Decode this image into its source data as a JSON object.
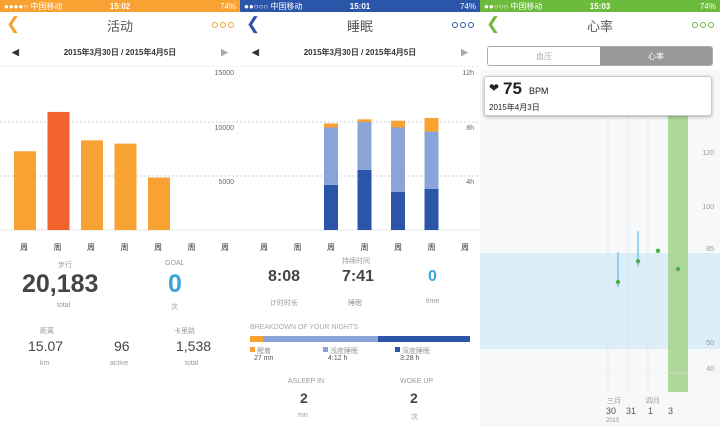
{
  "activity": {
    "status": {
      "carrier": "●●●●○ 中国移动",
      "time": "15:02",
      "battery": "74%"
    },
    "title": "活动",
    "date_range": "2015年3月30日 / 2015年4月5日",
    "ticks": [
      "15000",
      "10000",
      "5000"
    ],
    "days": [
      "周",
      "周",
      "周",
      "周",
      "周",
      "周",
      "周"
    ],
    "accent": "#f7a233",
    "highlight": "#f2622d",
    "steps_label": "步行",
    "steps_value": "20,183",
    "steps_unit": "total",
    "goal_label": "GOAL",
    "goal_value": "0",
    "goal_unit": "次",
    "distance_label": "距离",
    "distance_value": "15.07",
    "distance_unit": "km",
    "active_value": "96",
    "active_unit": "active",
    "calories_label": "卡里路",
    "calories_value": "1,538",
    "calories_unit": "total"
  },
  "sleep": {
    "status": {
      "carrier": "●●○○○ 中国移动",
      "time": "15:01",
      "battery": "74%"
    },
    "title": "睡眠",
    "date_range": "2015年3月30日 / 2015年4月5日",
    "ticks": [
      "12h",
      "8h",
      "4h"
    ],
    "days": [
      "周",
      "周",
      "周",
      "周",
      "周",
      "周",
      "周"
    ],
    "accent": "#2b55a8",
    "duration_label": "持续时间",
    "timer_value": "8:08",
    "timer_unit": "计时时长",
    "sleep_value": "7:41",
    "sleep_unit": "睡眠",
    "time_value": "0",
    "time_unit": "time",
    "breakdown_title": "BREAKDOWN OF YOUR NIGHTS",
    "awake_label": "醒着",
    "awake_value": "27 mn",
    "light_label": "浅度睡眠",
    "light_value": "4:12 h",
    "deep_label": "深度睡眠",
    "deep_value": "3:28 h",
    "asleep_label": "ASLEEP IN",
    "asleep_value": "2",
    "asleep_unit": "mn",
    "woke_label": "WOKE UP",
    "woke_value": "2",
    "woke_unit": "次"
  },
  "heart": {
    "status": {
      "carrier": "●●○○○ 中国移动",
      "time": "15:03",
      "battery": "74%"
    },
    "title": "心率",
    "tab_bp": "血压",
    "tab_hr": "心率",
    "tooltip_value": "75",
    "tooltip_unit": "BPM",
    "tooltip_date": "2015年4月3日",
    "ticks": [
      "120",
      "100",
      "85",
      "50",
      "40"
    ],
    "x_month1": "三月",
    "x_month2": "四月",
    "x_days": [
      "30",
      "31",
      "1",
      "3"
    ],
    "x_year": "2015",
    "accent": "#6cbb3c"
  },
  "chart_data": [
    {
      "type": "bar",
      "title": "活动",
      "categories": [
        "周",
        "周",
        "周",
        "周",
        "周",
        "周",
        "周"
      ],
      "values": [
        7200,
        10800,
        8200,
        7900,
        4800,
        0,
        0
      ],
      "ylim": [
        0,
        15000
      ]
    },
    {
      "type": "bar",
      "title": "睡眠",
      "categories": [
        "周",
        "周",
        "周",
        "周",
        "周",
        "周",
        "周"
      ],
      "series": [
        {
          "name": "深度睡眠",
          "values": [
            0,
            0,
            3.3,
            4.4,
            2.8,
            3.0,
            0
          ]
        },
        {
          "name": "浅度睡眠",
          "values": [
            0,
            0,
            4.2,
            3.5,
            4.7,
            4.2,
            0
          ]
        },
        {
          "name": "醒着",
          "values": [
            0,
            0,
            0.3,
            0.2,
            0.5,
            1.0,
            0
          ]
        }
      ],
      "ylim": [
        0,
        12
      ]
    },
    {
      "type": "scatter",
      "title": "心率",
      "x": [
        "30",
        "31",
        "1",
        "3"
      ],
      "y": [
        70,
        78,
        82,
        75
      ],
      "ylim": [
        35,
        140
      ]
    }
  ]
}
